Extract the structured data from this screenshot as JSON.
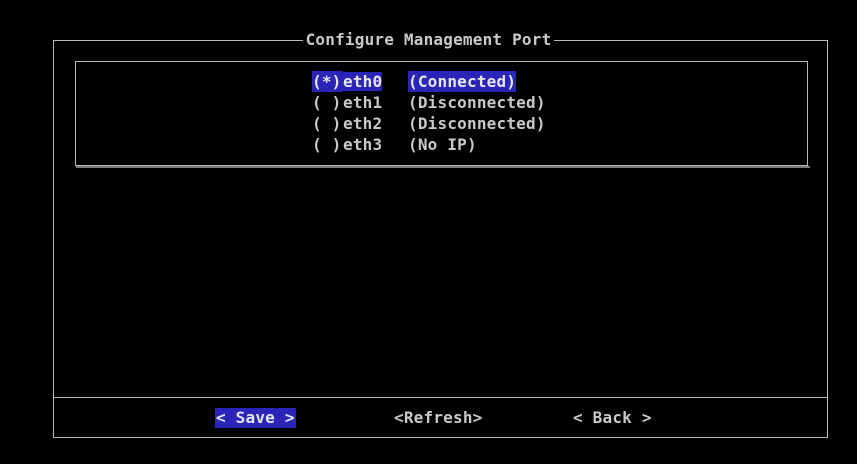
{
  "dialog": {
    "title": "Configure Management Port"
  },
  "ports": [
    {
      "radio": "(*)",
      "name": "eth0",
      "status": "(Connected)",
      "selected": true
    },
    {
      "radio": "( )",
      "name": "eth1",
      "status": "(Disconnected)",
      "selected": false
    },
    {
      "radio": "( )",
      "name": "eth2",
      "status": "(Disconnected)",
      "selected": false
    },
    {
      "radio": "( )",
      "name": "eth3",
      "status": "(No IP)",
      "selected": false
    }
  ],
  "buttons": {
    "save": "< Save >",
    "refresh": "<Refresh>",
    "back": "< Back >"
  },
  "colors": {
    "background": "#000000",
    "text": "#c9c9c9",
    "highlight": "#2a24b8"
  }
}
